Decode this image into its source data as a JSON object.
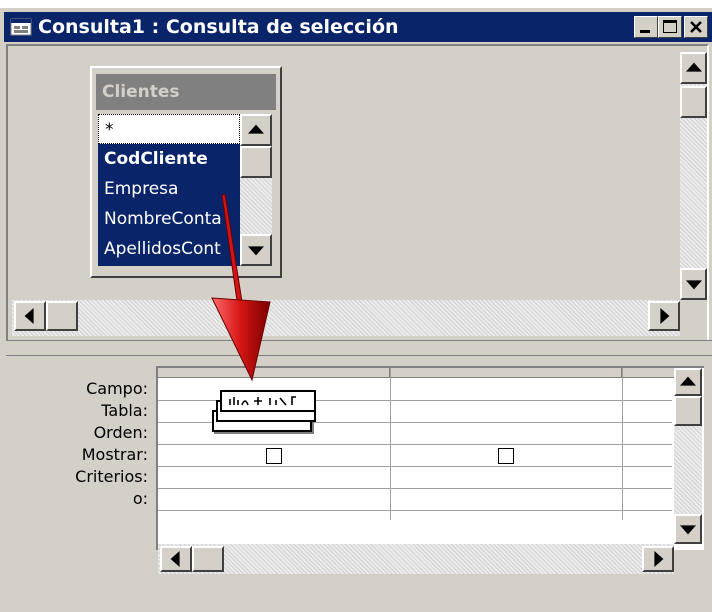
{
  "window": {
    "title": "Consulta1 : Consulta de selección",
    "title_bar_color": "#0a246a",
    "icon": "query-window-icon",
    "controls": [
      "minimize-icon",
      "maximize-icon",
      "close-icon"
    ]
  },
  "field_list": {
    "title": "Clientes",
    "items": [
      "*",
      "CodCliente",
      "Empresa",
      "NombreConta",
      "ApellidosCont"
    ],
    "selected_item": "CodCliente",
    "selection_color": "#0a246a"
  },
  "grid": {
    "row_labels": [
      "Campo:",
      "Tabla:",
      "Orden:",
      "Mostrar:",
      "Criterios:",
      "o:"
    ]
  },
  "drag": {
    "icon": "drag-field-icon",
    "arrow_color": "#d41414"
  }
}
